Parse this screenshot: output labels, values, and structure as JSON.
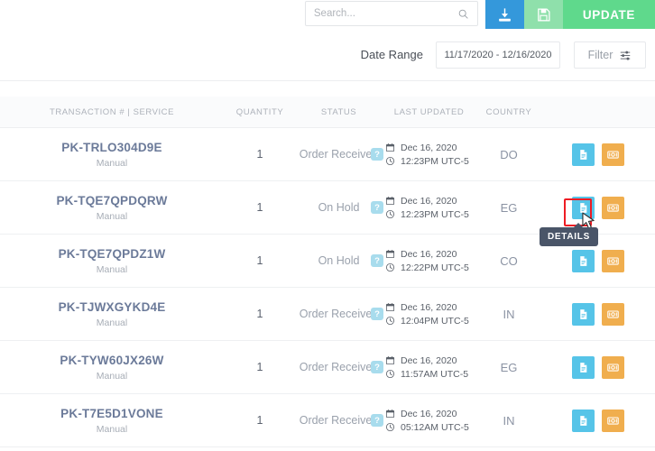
{
  "toolbar": {
    "search_placeholder": "Search...",
    "search_value": "",
    "search_icon": "search-icon",
    "download_icon": "download-icon",
    "save_icon": "floppy-save-icon",
    "update_label": "UPDATE"
  },
  "filterbar": {
    "date_range_label": "Date Range",
    "date_range_value": "11/17/2020 - 12/16/2020",
    "filter_label": "Filter",
    "filter_icon": "sliders-icon"
  },
  "table": {
    "columns": [
      "TRANSACTION # | SERVICE",
      "QUANTITY",
      "STATUS",
      "LAST UPDATED",
      "COUNTRY"
    ],
    "help_badge": "?",
    "calendar_icon": "calendar-icon",
    "clock_icon": "clock-icon",
    "details_icon": "document-icon",
    "payment_icon": "money-icon",
    "rows": [
      {
        "txn": "PK-TRLO304D9E",
        "service": "Manual",
        "quantity": "1",
        "status": "Order Received",
        "date": "Dec 16, 2020",
        "time": "12:23PM UTC-5",
        "country": "DO"
      },
      {
        "txn": "PK-TQE7QPDQRW",
        "service": "Manual",
        "quantity": "1",
        "status": "On Hold",
        "date": "Dec 16, 2020",
        "time": "12:23PM UTC-5",
        "country": "EG"
      },
      {
        "txn": "PK-TQE7QPDZ1W",
        "service": "Manual",
        "quantity": "1",
        "status": "On Hold",
        "date": "Dec 16, 2020",
        "time": "12:22PM UTC-5",
        "country": "CO"
      },
      {
        "txn": "PK-TJWXGYKD4E",
        "service": "Manual",
        "quantity": "1",
        "status": "Order Received",
        "date": "Dec 16, 2020",
        "time": "12:04PM UTC-5",
        "country": "IN"
      },
      {
        "txn": "PK-TYW60JX26W",
        "service": "Manual",
        "quantity": "1",
        "status": "Order Received",
        "date": "Dec 16, 2020",
        "time": "11:57AM UTC-5",
        "country": "EG"
      },
      {
        "txn": "PK-T7E5D1VONE",
        "service": "Manual",
        "quantity": "1",
        "status": "Order Received",
        "date": "Dec 16, 2020",
        "time": "05:12AM UTC-5",
        "country": "IN"
      }
    ]
  },
  "tooltip": {
    "label": "DETAILS",
    "on_row_index": 1
  },
  "colors": {
    "download_blue": "#3498db",
    "save_green": "#8fe0ab",
    "update_green": "#5fd98c",
    "details_blue": "#56c4e8",
    "payment_orange": "#f0ae4e",
    "badge_blue": "#a8dced",
    "tooltip_dark": "#4a5568",
    "highlight_red": "#ee1c24",
    "txn_link": "#6b7a99"
  }
}
